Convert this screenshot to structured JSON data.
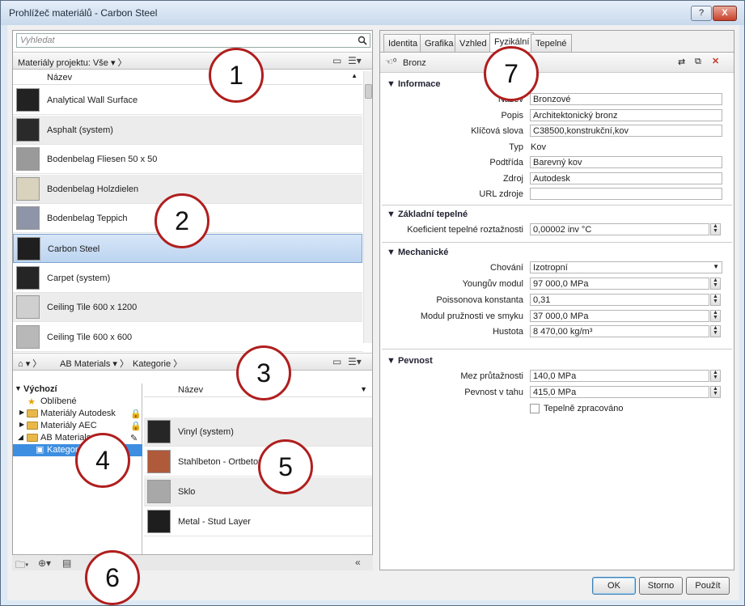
{
  "window": {
    "title": "Prohlížeč materiálů - Carbon Steel",
    "help_label": "?",
    "close_label": "X"
  },
  "search": {
    "placeholder": "Vyhledat"
  },
  "project_bar": {
    "label": "Materiály projektu: Vše"
  },
  "list": {
    "column": "Název",
    "items": [
      {
        "name": "Analytical Wall Surface",
        "color": "#222222"
      },
      {
        "name": "Asphalt (system)",
        "color": "#2a2a2a"
      },
      {
        "name": "Bodenbelag Fliesen 50 x 50",
        "color": "#9a9a9a"
      },
      {
        "name": "Bodenbelag Holzdielen",
        "color": "#d9d2bd"
      },
      {
        "name": "Bodenbelag Teppich",
        "color": "#8e95a8"
      },
      {
        "name": "Carbon Steel",
        "color": "#1f1f1f"
      },
      {
        "name": "Carpet (system)",
        "color": "#252525"
      },
      {
        "name": "Ceiling Tile 600 x 1200",
        "color": "#cfcfcf"
      },
      {
        "name": "Ceiling Tile 600 x 600",
        "color": "#b8b8b8"
      }
    ]
  },
  "library_bar": {
    "crumb1": "AB Materials",
    "crumb2": "Kategorie"
  },
  "tree": {
    "items": [
      {
        "label": "Výchozí"
      },
      {
        "label": "Oblíbené"
      },
      {
        "label": "Materiály Autodesk"
      },
      {
        "label": "Materiály AEC"
      },
      {
        "label": "AB Materials"
      },
      {
        "label": "Kategorie"
      }
    ]
  },
  "library_list": {
    "column": "Název",
    "items": [
      {
        "name": "Vinyl (system)",
        "color": "#262626"
      },
      {
        "name": "Stahlbeton - Ortbeton - Rot",
        "color": "#b05a3c"
      },
      {
        "name": "Sklo",
        "color": "#a8a8a8"
      },
      {
        "name": "Metal - Stud Layer",
        "color": "#1e1e1e"
      }
    ]
  },
  "tabs": [
    "Identita",
    "Grafika",
    "Vzhled",
    "Fyzikální",
    "Tepelné"
  ],
  "asset": {
    "name": "Bronz"
  },
  "sections": {
    "info": "Informace",
    "thermal": "Základní tepelné",
    "mech": "Mechanické",
    "strength": "Pevnost"
  },
  "properties": {
    "name": {
      "label": "Název",
      "value": "Bronzové"
    },
    "desc": {
      "label": "Popis",
      "value": "Architektonický bronz"
    },
    "keywords": {
      "label": "Klíčová slova",
      "value": "C38500,konstrukční,kov"
    },
    "type": {
      "label": "Typ",
      "value": "Kov"
    },
    "subclass": {
      "label": "Podtřída",
      "value": "Barevný kov"
    },
    "source": {
      "label": "Zdroj",
      "value": "Autodesk"
    },
    "url": {
      "label": "URL zdroje",
      "value": ""
    },
    "expansion": {
      "label": "Koeficient tepelné roztažnosti",
      "value": "0,00002 inv °C"
    },
    "behavior": {
      "label": "Chování",
      "value": "Izotropní"
    },
    "young": {
      "label": "Youngův modul",
      "value": "97 000,0 MPa"
    },
    "poisson": {
      "label": "Poissonova konstanta",
      "value": "0,31"
    },
    "shear": {
      "label": "Modul pružnosti ve smyku",
      "value": "37 000,0 MPa"
    },
    "density": {
      "label": "Hustota",
      "value": "8 470,00 kg/m³"
    },
    "yield": {
      "label": "Mez průtažnosti",
      "value": "140,0 MPa"
    },
    "tensile": {
      "label": "Pevnost v tahu",
      "value": "415,0 MPa"
    },
    "thermally_treated": {
      "label": "Tepelně zpracováno"
    }
  },
  "buttons": {
    "ok": "OK",
    "cancel": "Storno",
    "apply": "Použít"
  },
  "markers": [
    "1",
    "2",
    "3",
    "4",
    "5",
    "6",
    "7"
  ]
}
